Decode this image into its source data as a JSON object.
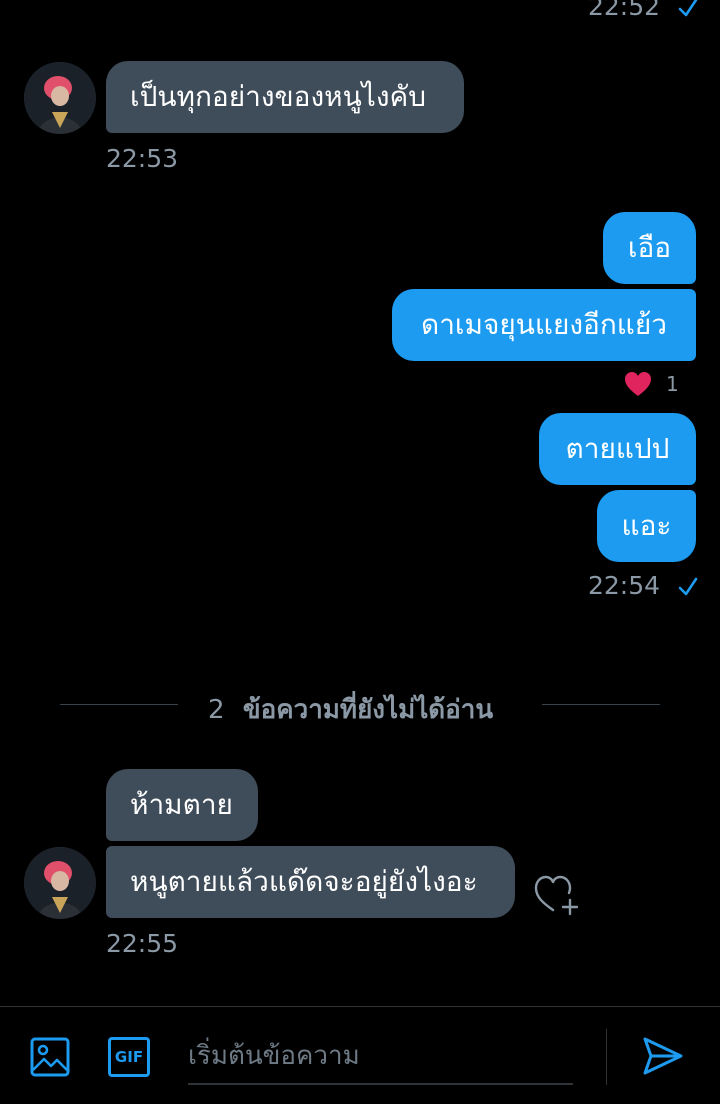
{
  "colors": {
    "background": "#000000",
    "incoming_bubble": "#3f4d5a",
    "outgoing_bubble": "#1d9bf0",
    "accent": "#1d9bf0",
    "timestamp": "#8b98a5",
    "heart": "#e0245e"
  },
  "top_status": {
    "time": "22:52",
    "icon": "check-icon"
  },
  "thread": {
    "incoming_1": {
      "text": "เป็นทุกอย่างของหนูไงคับ",
      "time": "22:53"
    },
    "outgoing": {
      "messages": [
        "เอือ",
        "ดาเมจยุนแยงอีกแย้ว",
        "ตายแปป",
        "แอะ"
      ],
      "reaction": {
        "icon": "heart-icon",
        "count": "1"
      },
      "time": "22:54",
      "status_icon": "check-icon"
    },
    "unread_divider": {
      "count": "2",
      "label": "ข้อความที่ยังไม่ได้อ่าน"
    },
    "incoming_2": {
      "messages": [
        "ห้ามตาย",
        "หนูตายแล้วแด๊ดจะอยู่ยังไงอะ"
      ],
      "reaction_icon": "heart-plus-icon",
      "time": "22:55"
    }
  },
  "composer": {
    "placeholder": "เริ่มต้นข้อความ",
    "value": "",
    "image_icon": "image-icon",
    "gif_label": "GIF",
    "send_icon": "send-icon"
  }
}
